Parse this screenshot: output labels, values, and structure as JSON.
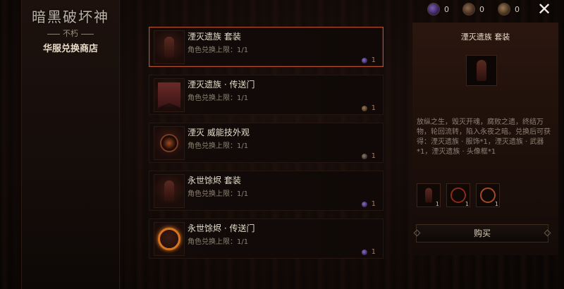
{
  "logo": {
    "title": "暗黑破坏神",
    "subtitle": "不朽"
  },
  "shop": {
    "title": "华服兑换商店"
  },
  "currency": [
    {
      "icon": "purple-orb-icon",
      "value": "0"
    },
    {
      "icon": "bronze-orb-icon",
      "value": "0"
    },
    {
      "icon": "gold-orb-icon",
      "value": "0"
    }
  ],
  "items": [
    {
      "name": "湮灭遗族 套装",
      "limit": "角色兑换上限：1/1",
      "price": "1",
      "thumb": "cosmetic-set-icon",
      "currency": "purple"
    },
    {
      "name": "湮灭遗族 · 传送门",
      "limit": "角色兑换上限：1/1",
      "price": "1",
      "thumb": "portal-banner-icon",
      "currency": "brown"
    },
    {
      "name": "湮灭 威能技外观",
      "limit": "角色兑换上限：1/1",
      "price": "1",
      "thumb": "skill-effect-icon",
      "currency": "gray"
    },
    {
      "name": "永世馀烬 套装",
      "limit": "角色兑换上限：1/1",
      "price": "1",
      "thumb": "cosmetic-set-icon",
      "currency": "purple"
    },
    {
      "name": "永世馀烬 · 传送门",
      "limit": "角色兑换上限：1/1",
      "price": "1",
      "thumb": "fire-portal-icon",
      "currency": "purple"
    }
  ],
  "detail": {
    "title": "湮灭遗族 套装",
    "description": "放纵之生，毁灭开魂，腐败之遗，终结万物，轮回流转，陷入永夜之暗。兑换后可获得：湮灭遗族 · 服饰*1，湮灭遗族 · 武器*1，湮灭遗族 · 头像框*1",
    "rewards": [
      {
        "name": "armor-cosmetic-icon",
        "count": "1"
      },
      {
        "name": "weapon-cosmetic-icon",
        "count": "1"
      },
      {
        "name": "avatar-frame-icon",
        "count": "1"
      }
    ],
    "buy_label": "购买"
  }
}
